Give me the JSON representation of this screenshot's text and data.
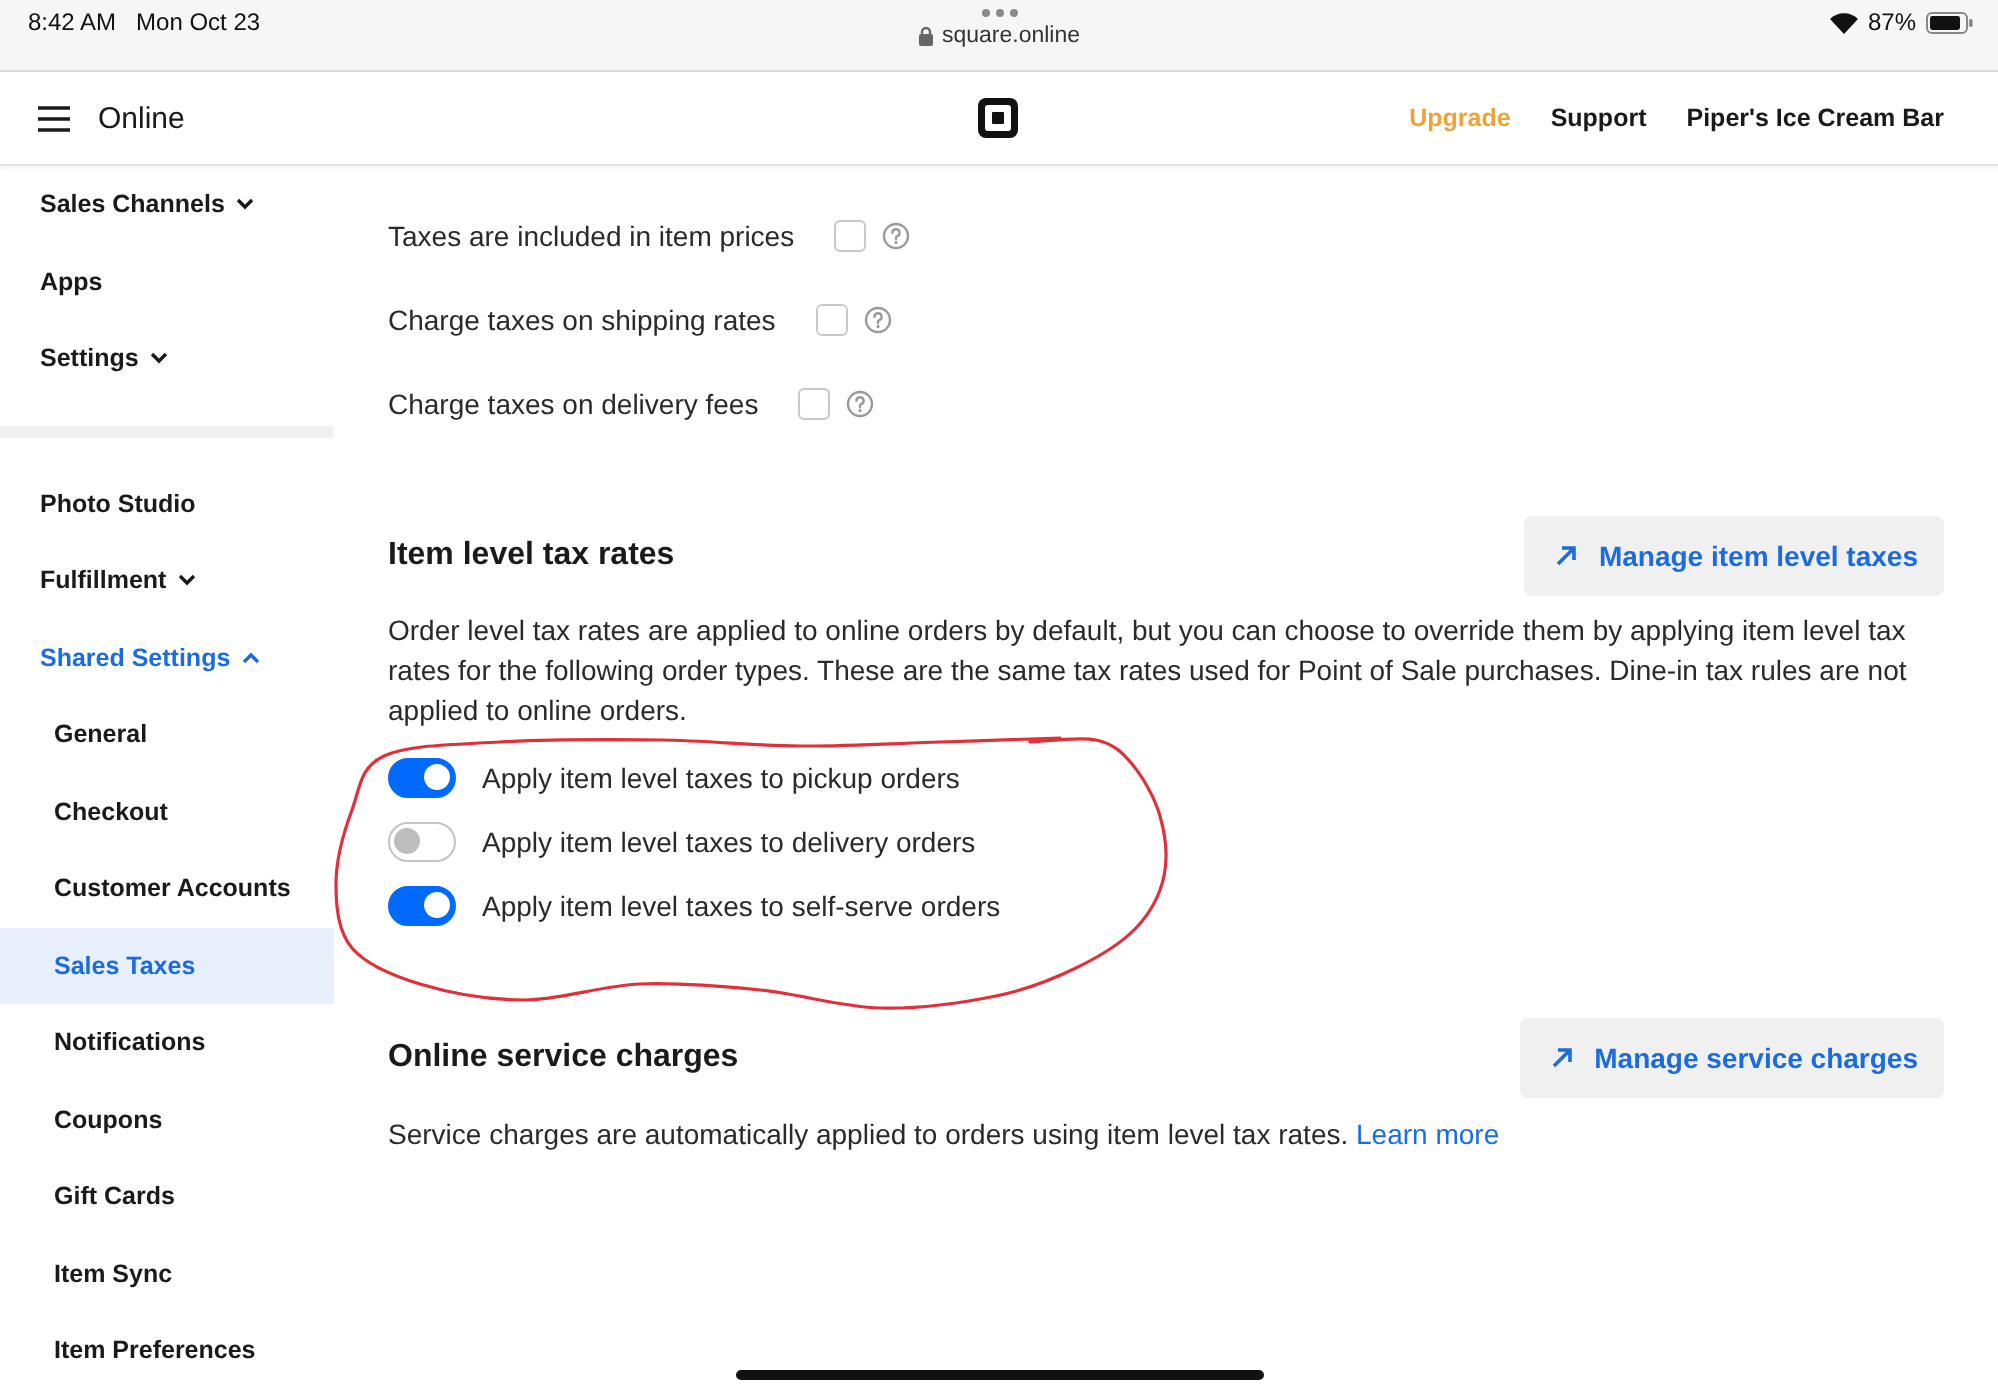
{
  "status_bar": {
    "time": "8:42 AM",
    "date": "Mon Oct 23",
    "url": "square.online",
    "battery": "87%"
  },
  "header": {
    "title": "Online",
    "links": [
      {
        "label": "Upgrade",
        "kind": "upgrade"
      },
      {
        "label": "Support",
        "kind": "link"
      },
      {
        "label": "Piper's Ice Cream Bar",
        "kind": "link"
      }
    ]
  },
  "sidebar": {
    "groups": [
      [
        {
          "label": "Sales Channels",
          "kind": "menu",
          "expanded": false,
          "selected": false
        },
        {
          "label": "Apps",
          "kind": "link",
          "selected": false
        },
        {
          "label": "Settings",
          "kind": "menu",
          "expanded": false,
          "selected": false
        }
      ],
      [
        {
          "label": "Photo Studio",
          "kind": "link",
          "selected": false
        },
        {
          "label": "Fulfillment",
          "kind": "menu",
          "expanded": false,
          "selected": false
        },
        {
          "label": "Shared Settings",
          "kind": "menu",
          "expanded": true,
          "selected": false,
          "children": [
            {
              "label": "General",
              "selected": false
            },
            {
              "label": "Checkout",
              "selected": false
            },
            {
              "label": "Customer Accounts",
              "selected": false
            },
            {
              "label": "Sales Taxes",
              "selected": true
            },
            {
              "label": "Notifications",
              "selected": false
            },
            {
              "label": "Coupons",
              "selected": false
            },
            {
              "label": "Gift Cards",
              "selected": false
            },
            {
              "label": "Item Sync",
              "selected": false
            },
            {
              "label": "Item Preferences",
              "selected": false
            }
          ]
        }
      ]
    ]
  },
  "tax_options": [
    {
      "label": "Taxes are included in item prices",
      "checked": false
    },
    {
      "label": "Charge taxes on shipping rates",
      "checked": false
    },
    {
      "label": "Charge taxes on delivery fees",
      "checked": false
    }
  ],
  "sections": [
    {
      "title": "Item level tax rates",
      "button": "Manage item level taxes",
      "description": "Order level tax rates are applied to online orders by default, but you can choose to override them by applying item level tax rates for the following order types. These are the same tax rates used for Point of Sale purchases. Dine-in tax rules are not applied to online orders.",
      "toggles": [
        {
          "label": "Apply item level taxes to pickup orders",
          "on": true
        },
        {
          "label": "Apply item level taxes to delivery orders",
          "on": false
        },
        {
          "label": "Apply item level taxes to self-serve orders",
          "on": true
        }
      ]
    },
    {
      "title": "Online service charges",
      "button": "Manage service charges",
      "description": "Service charges are automatically applied to orders using item level tax rates.",
      "link": "Learn more"
    }
  ]
}
